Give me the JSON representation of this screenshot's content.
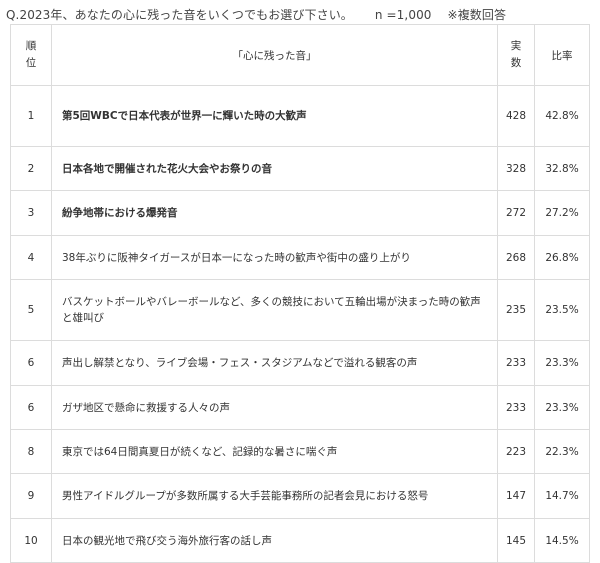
{
  "question": {
    "text": "Q.2023年、あなたの心に残った音をいくつでもお選び下さい。",
    "n": "n =1,000",
    "note": "※複数回答"
  },
  "table": {
    "headers": {
      "rank": [
        "順",
        "位"
      ],
      "sound": "「心に残った音」",
      "count": [
        "実",
        "数"
      ],
      "ratio": "比率"
    },
    "rows": [
      {
        "rank": "1",
        "sound": "第5回WBCで日本代表が世界一に輝いた時の大歓声",
        "count": "428",
        "ratio": "42.8%"
      },
      {
        "rank": "2",
        "sound": "日本各地で開催された花火大会やお祭りの音",
        "count": "328",
        "ratio": "32.8%"
      },
      {
        "rank": "3",
        "sound": "紛争地帯における爆発音",
        "count": "272",
        "ratio": "27.2%"
      },
      {
        "rank": "4",
        "sound": "38年ぶりに阪神タイガースが日本一になった時の歓声や街中の盛り上がり",
        "count": "268",
        "ratio": "26.8%"
      },
      {
        "rank": "5",
        "sound": "バスケットボールやバレーボールなど、多くの競技において五輪出場が決まった時の歓声と雄叫び",
        "count": "235",
        "ratio": "23.5%"
      },
      {
        "rank": "6",
        "sound": "声出し解禁となり、ライブ会場・フェス・スタジアムなどで溢れる観客の声",
        "count": "233",
        "ratio": "23.3%"
      },
      {
        "rank": "6",
        "sound": "ガザ地区で懸命に救援する人々の声",
        "count": "233",
        "ratio": "23.3%"
      },
      {
        "rank": "8",
        "sound": "東京では64日間真夏日が続くなど、記録的な暑さに喘ぐ声",
        "count": "223",
        "ratio": "22.3%"
      },
      {
        "rank": "9",
        "sound": "男性アイドルグループが多数所属する大手芸能事務所の記者会見における怒号",
        "count": "147",
        "ratio": "14.7%"
      },
      {
        "rank": "10",
        "sound": "日本の観光地で飛び交う海外旅行客の話し声",
        "count": "145",
        "ratio": "14.5%"
      }
    ]
  }
}
